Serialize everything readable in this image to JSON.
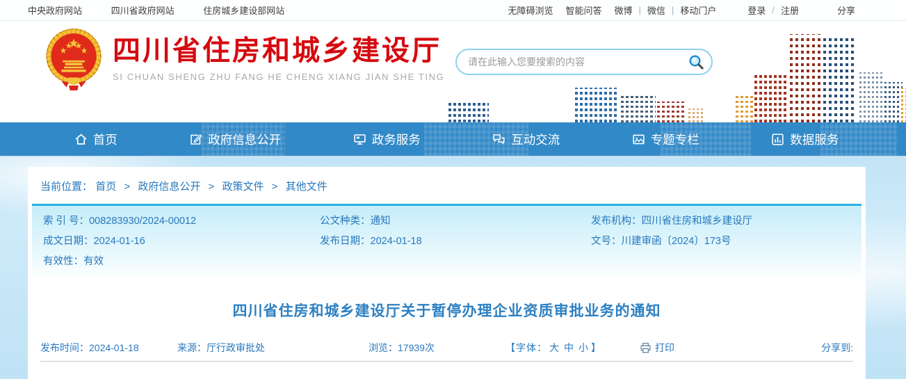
{
  "topbar": {
    "left_links": [
      "中央政府网站",
      "四川省政府网站",
      "住房城乡建设部网站"
    ],
    "accessibility": "无障碍浏览",
    "smart_qa": "智能问答",
    "weibo": "微博",
    "wechat": "微信",
    "mobile_portal": "移动门户",
    "pipe": "|",
    "login": "登录",
    "slash": "/",
    "register": "注册",
    "share": "分享"
  },
  "header": {
    "site_title": "四川省住房和城乡建设厅",
    "site_subtitle": "SI CHUAN SHENG ZHU FANG HE CHENG XIANG JIAN SHE TING",
    "search_placeholder": "请在此输入您要搜索的内容",
    "logo_icon": "china-national-emblem",
    "search_icon": "magnifier"
  },
  "nav": {
    "items": [
      {
        "label": "首页",
        "icon": "home-icon"
      },
      {
        "label": "政府信息公开",
        "icon": "info-disclosure-icon"
      },
      {
        "label": "政务服务",
        "icon": "gov-services-icon"
      },
      {
        "label": "互动交流",
        "icon": "interaction-icon"
      },
      {
        "label": "专题专栏",
        "icon": "topics-icon"
      },
      {
        "label": "数据服务",
        "icon": "data-services-icon"
      }
    ]
  },
  "breadcrumb": {
    "location_label": "当前位置：",
    "separator": ">",
    "items": [
      "首页",
      "政府信息公开",
      "政策文件",
      "其他文件"
    ]
  },
  "doc_meta": {
    "index_label": "索 引 号：",
    "index_value": "008283930/2024-00012",
    "doc_type_label": "公文种类：",
    "doc_type_value": "通知",
    "agency_label": "发布机构：",
    "agency_value": "四川省住房和城乡建设厅",
    "written_date_label": "成文日期：",
    "written_date_value": "2024-01-16",
    "publish_date_label": "发布日期：",
    "publish_date_value": "2024-01-18",
    "doc_no_label": "文号：",
    "doc_no_value": "川建审函〔2024〕173号",
    "validity_label": "有效性：",
    "validity_value": "有效"
  },
  "article": {
    "title": "四川省住房和城乡建设厅关于暂停办理企业资质审批业务的通知",
    "publish_time_label": "发布时间：",
    "publish_time_value": "2024-01-18",
    "source_label": "来源：",
    "source_value": "厅行政审批处",
    "views_label": "浏览：",
    "views_value": "17939次",
    "font_open": "【字体：",
    "font_large": "大",
    "font_medium": "中",
    "font_small": "小",
    "font_close": "】",
    "print_label": "打印",
    "print_icon": "printer",
    "share_to_label": "分享到:"
  },
  "colors": {
    "nav_blue": "#3289c7",
    "brand_red": "#d50a0f",
    "link_blue": "#2878be",
    "meta_box_border": "#2ab0e6",
    "meta_box_bg_top": "#c6edf9",
    "article_title_blue": "#2d80c2"
  }
}
